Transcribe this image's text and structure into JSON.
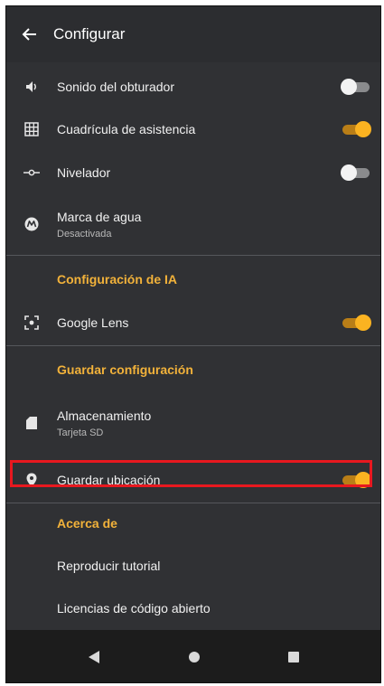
{
  "header": {
    "title": "Configurar",
    "back_icon": "arrow-left-icon"
  },
  "settings": {
    "shutter_sound": {
      "label": "Sonido del obturador",
      "icon": "speaker-icon",
      "enabled": false
    },
    "grid": {
      "label": "Cuadrícula de asistencia",
      "icon": "grid-icon",
      "enabled": true
    },
    "leveler": {
      "label": "Nivelador",
      "icon": "level-icon",
      "enabled": false
    },
    "watermark": {
      "label": "Marca de agua",
      "sublabel": "Desactivada",
      "icon": "motorola-logo-icon"
    }
  },
  "ai_section": {
    "header": "Configuración de IA",
    "google_lens": {
      "label": "Google Lens",
      "icon": "lens-icon",
      "enabled": true
    }
  },
  "save_section": {
    "header": "Guardar configuración",
    "storage": {
      "label": "Almacenamiento",
      "sublabel": "Tarjeta SD",
      "icon": "sd-card-icon"
    },
    "save_location": {
      "label": "Guardar ubicación",
      "icon": "location-pin-icon",
      "enabled": true
    }
  },
  "about_section": {
    "header": "Acerca de",
    "tutorial": {
      "label": "Reproducir tutorial"
    },
    "licenses": {
      "label": "Licencias de código abierto"
    }
  },
  "navbar": {
    "back_icon": "nav-back-icon",
    "home_icon": "nav-home-icon",
    "recents_icon": "nav-recents-icon"
  },
  "colors": {
    "background": "#303134",
    "accent": "#f2b23a",
    "toggle_on_thumb": "#fbb321",
    "toggle_on_track": "#b97e17",
    "highlight": "#e8181f"
  }
}
